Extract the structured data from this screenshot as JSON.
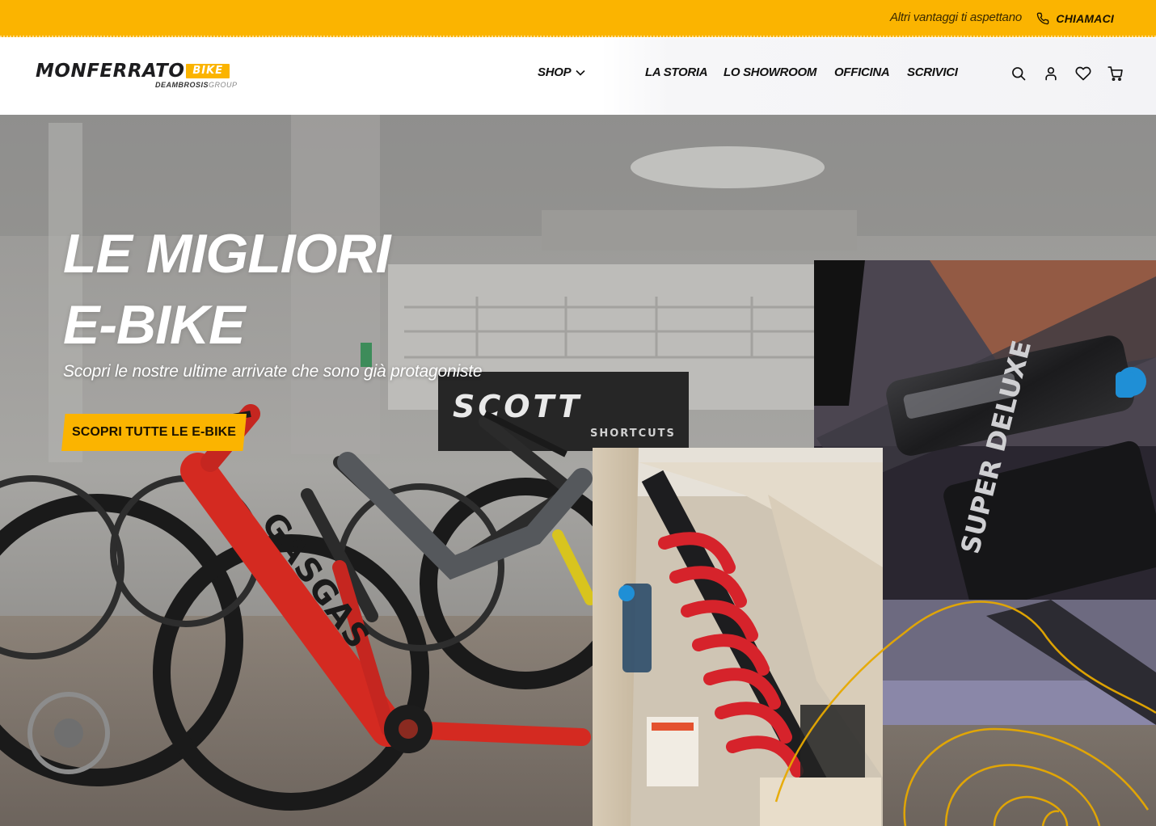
{
  "topbar": {
    "promo_text": "Altri vantaggi ti aspettano",
    "call_label": "CHIAMACI",
    "call_icon": "phone-icon",
    "background_color": "#fbb400"
  },
  "header": {
    "logo": {
      "brand": "MONFERRATO",
      "badge": "BIKE",
      "group_bold": "DEAMBROSIS",
      "group_light": "GROUP"
    },
    "nav": [
      {
        "label": "SHOP",
        "has_dropdown": true
      },
      {
        "label": "LA STORIA"
      },
      {
        "label": "LO SHOWROOM"
      },
      {
        "label": "OFFICINA"
      },
      {
        "label": "SCRIVICI"
      }
    ],
    "icons": [
      "search-icon",
      "account-icon",
      "heart-icon",
      "cart-icon"
    ]
  },
  "hero": {
    "title_line1": "LE MIGLIORI",
    "title_line2": "E-BIKE",
    "subtitle": "Scopri le nostre ultime arrivate che sono già protagoniste",
    "cta_label": "SCOPRI TUTTE LE E-BIKE",
    "showroom_sign": "SCOTT",
    "sign_tagline": "SHORTCUTS",
    "bike_frame_text": "GASGAS",
    "shock_text": "SUPER DELUXE",
    "accent_color": "#fbb400"
  }
}
